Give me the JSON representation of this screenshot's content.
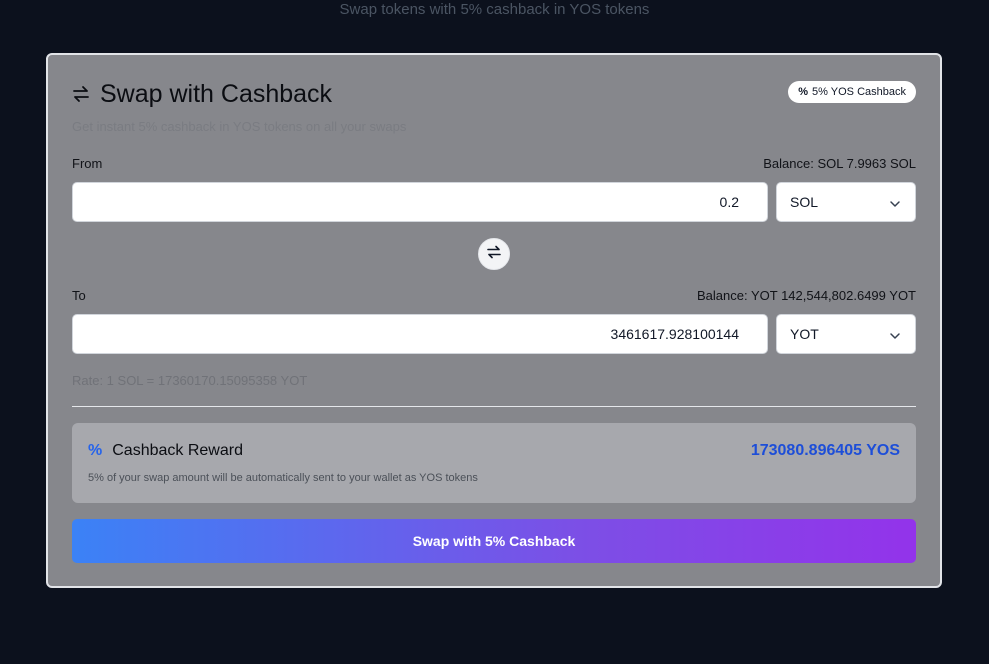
{
  "page": {
    "subtitle": "Swap tokens with 5% cashback in YOS tokens"
  },
  "card": {
    "title": "Swap with Cashback",
    "subtitle": "Get instant 5% cashback in YOS tokens on all your swaps",
    "badge_icon": "%",
    "badge_label": "5% YOS Cashback"
  },
  "from": {
    "label": "From",
    "balance": "Balance: SOL 7.9963 SOL",
    "amount": "0.2",
    "token": "SOL"
  },
  "to": {
    "label": "To",
    "balance": "Balance: YOT 142,544,802.6499 YOT",
    "amount": "3461617.928100144",
    "token": "YOT"
  },
  "rate": "Rate: 1 SOL = 17360170.15095358 YOT",
  "reward": {
    "icon": "%",
    "title": "Cashback Reward",
    "amount": "173080.896405 YOS",
    "description": "5% of your swap amount will be automatically sent to your wallet as YOS tokens"
  },
  "action": {
    "swap_label": "Swap with 5% Cashback"
  },
  "colors": {
    "background": "#0c111d",
    "card": "#86878c",
    "accent_blue": "#1d4ed8",
    "gradient_start": "#3b82f6",
    "gradient_end": "#9333ea"
  },
  "icons": {
    "swap": "swap-arrows-icon",
    "flip": "flip-arrows-icon",
    "chevron": "chevron-down-icon",
    "percent": "percent-icon"
  }
}
